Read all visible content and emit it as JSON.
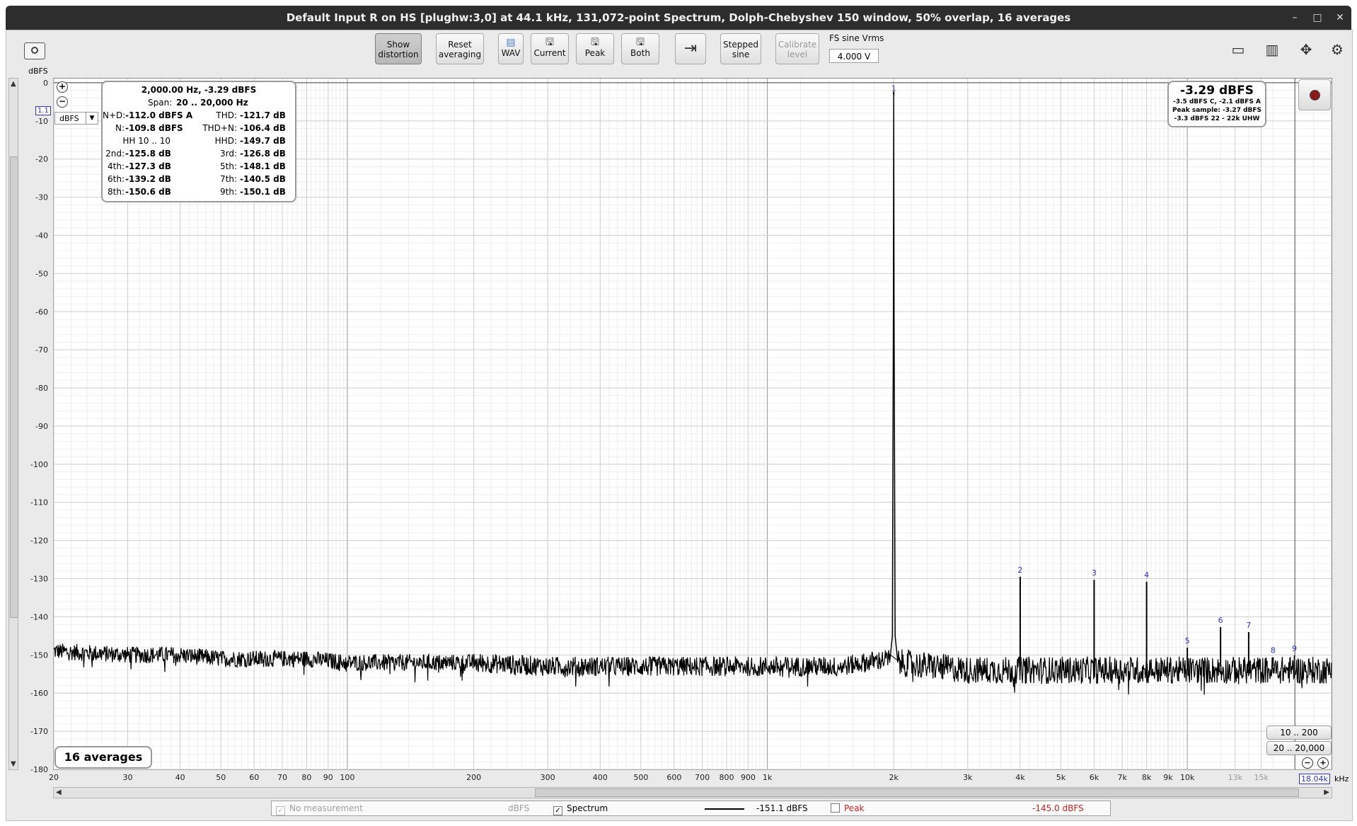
{
  "window": {
    "title": "Default Input R on HS [plughw:3,0] at 44.1 kHz, 131,072-point Spectrum, Dolph-Chebyshev 150 window, 50% overlap, 16 averages",
    "minimize_glyph": "–",
    "maximize_glyph": "□",
    "close_glyph": "✕"
  },
  "toolbar": {
    "show_distortion": "Show\ndistortion",
    "reset_averaging": "Reset\naveraging",
    "wav": "WAV",
    "current": "Current",
    "peak": "Peak",
    "both": "Both",
    "stepped_sine": "Stepped\nsine",
    "calibrate_level": "Calibrate\nlevel",
    "fs_label": "FS sine Vrms",
    "fs_value": "4.000 V"
  },
  "unit_selector": "dBFS",
  "infobox": {
    "freq_level": "2,000.00 Hz, -3.29 dBFS",
    "span_label": "Span:",
    "span": "20 .. 20,000 Hz",
    "rows": [
      {
        "l1": "N+D:",
        "v1": "-112.0 dBFS A",
        "l2": "THD:",
        "v2": "-121.7 dB"
      },
      {
        "l1": "N:",
        "v1": "-109.8 dBFS",
        "l2": "THD+N:",
        "v2": "-106.4 dB"
      },
      {
        "l1": "HH 10 .. 10",
        "v1": "",
        "l2": "HHD:",
        "v2": "-149.7 dB"
      },
      {
        "l1": "2nd:",
        "v1": "-125.8 dB",
        "l2": "3rd:",
        "v2": "-126.8 dB"
      },
      {
        "l1": "4th:",
        "v1": "-127.3 dB",
        "l2": "5th:",
        "v2": "-148.1 dB"
      },
      {
        "l1": "6th:",
        "v1": "-139.2 dB",
        "l2": "7th:",
        "v2": "-140.5 dB"
      },
      {
        "l1": "8th:",
        "v1": "-150.6 dB",
        "l2": "9th:",
        "v2": "-150.1 dB"
      }
    ]
  },
  "readout": {
    "main": "-3.29 dBFS",
    "line1": "-3.5 dBFS C, -2.1 dBFS A",
    "line2": "Peak sample: -3.27 dBFS",
    "line3": "-3.3 dBFS 22 - 22k UHW"
  },
  "range_buttons": {
    "low": "10 .. 200",
    "full": "20 .. 20,000"
  },
  "averages_badge": "16 averages",
  "cursor_freq": "18.04k",
  "x_unit": "kHz",
  "y_marker": "1.1",
  "legend": {
    "no_measurement": "No measurement",
    "no_measurement_unit": "dBFS",
    "spectrum": "Spectrum",
    "spectrum_value": "-151.1 dBFS",
    "peak": "Peak",
    "peak_value": "-145.0 dBFS",
    "peak_color": "#cc2222"
  },
  "chart_data": {
    "type": "line",
    "title": "",
    "xlabel": "",
    "ylabel": "dBFS",
    "x_scale": "log",
    "xlim": [
      20,
      22050
    ],
    "ylim": [
      -180,
      1.1
    ],
    "grid": true,
    "x_ticks": [
      {
        "v": 20,
        "t": "20"
      },
      {
        "v": 30,
        "t": "30"
      },
      {
        "v": 40,
        "t": "40"
      },
      {
        "v": 50,
        "t": "50"
      },
      {
        "v": 60,
        "t": "60"
      },
      {
        "v": 70,
        "t": "70"
      },
      {
        "v": 80,
        "t": "80"
      },
      {
        "v": 90,
        "t": "90"
      },
      {
        "v": 100,
        "t": "100"
      },
      {
        "v": 200,
        "t": "200"
      },
      {
        "v": 300,
        "t": "300"
      },
      {
        "v": 400,
        "t": "400"
      },
      {
        "v": 500,
        "t": "500"
      },
      {
        "v": 600,
        "t": "600"
      },
      {
        "v": 700,
        "t": "700"
      },
      {
        "v": 800,
        "t": "800"
      },
      {
        "v": 900,
        "t": "900"
      },
      {
        "v": 1000,
        "t": "1k"
      },
      {
        "v": 2000,
        "t": "2k"
      },
      {
        "v": 3000,
        "t": "3k"
      },
      {
        "v": 4000,
        "t": "4k"
      },
      {
        "v": 5000,
        "t": "5k"
      },
      {
        "v": 6000,
        "t": "6k"
      },
      {
        "v": 7000,
        "t": "7k"
      },
      {
        "v": 8000,
        "t": "8k"
      },
      {
        "v": 9000,
        "t": "9k"
      },
      {
        "v": 10000,
        "t": "10k"
      },
      {
        "v": 13000,
        "t": "13k"
      },
      {
        "v": 15000,
        "t": "15k"
      }
    ],
    "y_ticks": [
      0,
      -10,
      -20,
      -30,
      -40,
      -50,
      -60,
      -70,
      -80,
      -90,
      -100,
      -110,
      -120,
      -130,
      -140,
      -150,
      -160,
      -170,
      -180
    ],
    "series": [
      {
        "name": "Spectrum",
        "color": "#000000",
        "noise_floor": [
          [
            20,
            -149
          ],
          [
            30,
            -150
          ],
          [
            40,
            -150
          ],
          [
            50,
            -151
          ],
          [
            60,
            -151
          ],
          [
            80,
            -151
          ],
          [
            100,
            -152
          ],
          [
            200,
            -152
          ],
          [
            300,
            -153
          ],
          [
            500,
            -153
          ],
          [
            700,
            -153
          ],
          [
            1000,
            -153
          ],
          [
            1500,
            -153
          ],
          [
            1950,
            -151
          ],
          [
            2000,
            -3.29
          ],
          [
            2050,
            -152
          ],
          [
            3000,
            -154
          ],
          [
            5000,
            -154
          ],
          [
            8000,
            -154
          ],
          [
            10000,
            -154
          ],
          [
            15000,
            -154
          ],
          [
            22050,
            -154
          ]
        ],
        "harmonics": [
          {
            "label": "1",
            "x": 2000,
            "y": -3.29
          },
          {
            "label": "2",
            "x": 4000,
            "y": -129.5
          },
          {
            "label": "3",
            "x": 6000,
            "y": -130.3
          },
          {
            "label": "4",
            "x": 8000,
            "y": -130.8
          },
          {
            "label": "5",
            "x": 10000,
            "y": -148.1
          },
          {
            "label": "6",
            "x": 12000,
            "y": -142.7
          },
          {
            "label": "7",
            "x": 14000,
            "y": -144.0
          },
          {
            "label": "8",
            "x": 16000,
            "y": -150.6
          },
          {
            "label": "9",
            "x": 18000,
            "y": -150.1
          }
        ]
      }
    ]
  }
}
